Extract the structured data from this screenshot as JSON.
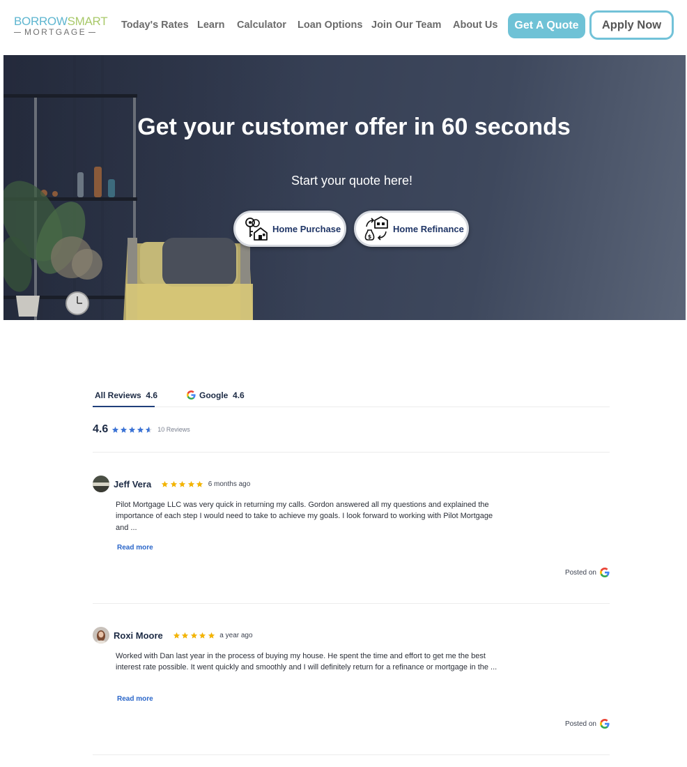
{
  "header": {
    "logo": {
      "part1": "BORROW",
      "part2": "SMART",
      "sub": "MORTGAGE"
    },
    "nav": [
      "Today's Rates",
      "Learn",
      "Calculator",
      "Loan Options",
      "Join Our Team",
      "About Us"
    ],
    "quote_button": "Get A Quote",
    "apply_button": "Apply Now"
  },
  "hero": {
    "title": "Get your customer offer in 60 seconds",
    "subtitle": "Start your quote here!",
    "options": [
      {
        "label": "Home Purchase",
        "icon": "keys-house-icon"
      },
      {
        "label": "Home Refinance",
        "icon": "house-refinance-icon"
      }
    ]
  },
  "reviews": {
    "tabs": [
      {
        "label": "All Reviews",
        "rating": "4.6"
      },
      {
        "label": "Google",
        "rating": "4.6",
        "icon": "google-icon"
      }
    ],
    "summary": {
      "rating": "4.6",
      "stars": 4.6,
      "count": "10 Reviews"
    },
    "items": [
      {
        "name": "Jeff Vera",
        "stars": 5,
        "time": "6 months ago",
        "text": "Pilot Mortgage LLC was very quick in returning my calls. Gordon answered all my questions and explained the importance of each step I would need to take to achieve my goals. I look forward to working with Pilot Mortgage and ...",
        "read_more": "Read more",
        "posted": "Posted on",
        "source_icon": "google-icon"
      },
      {
        "name": "Roxi Moore",
        "stars": 5,
        "time": "a year ago",
        "text": "Worked with Dan last year in the process of buying my house. He spent the time and effort to get me the best interest rate possible. It went quickly and smoothly and I will definitely return for a refinance or mortgage in the ...",
        "read_more": "Read more",
        "posted": "Posted on",
        "source_icon": "google-icon"
      }
    ]
  },
  "colors": {
    "accent": "#6fc2d6",
    "navy": "#1f3566",
    "review_star": "#f4b400",
    "summary_star": "#3b73d6",
    "link": "#2a66c9"
  }
}
